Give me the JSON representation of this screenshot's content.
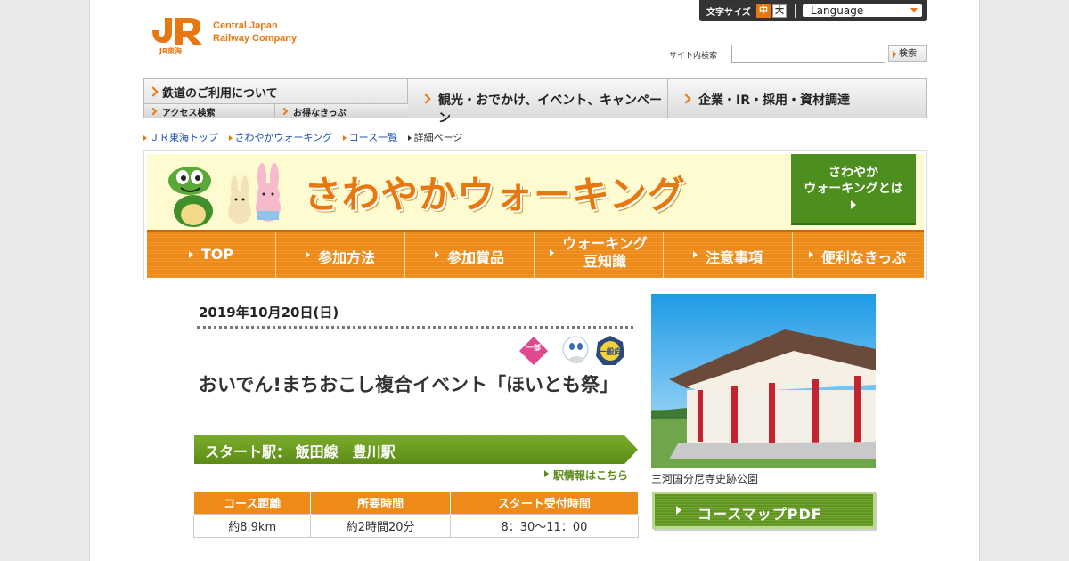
{
  "header": {
    "logo_line1": "Central Japan",
    "logo_line2": "Railway Company",
    "logo_sub": "JR東海",
    "font_size_label": "文字サイズ",
    "font_mid": "中",
    "font_big": "大",
    "language": "Language",
    "search_label": "サイト内検索",
    "search_value": "",
    "search_button": "検索"
  },
  "gnav": {
    "main1": "鉄道のご利用について",
    "sub1": "アクセス検索",
    "sub2": "お得なきっぷ",
    "main2": "観光・おでかけ、イベント、キャンペーン",
    "main3": "企業・IR・採用・資材調達"
  },
  "breadcrumb": [
    "ＪＲ東海トップ",
    "さわやかウォーキング",
    "コース一覧",
    "詳細ページ"
  ],
  "banner": {
    "title": "さわやかウォーキング",
    "whatis_line1": "さわやか",
    "whatis_line2": "ウォーキングとは",
    "nav": [
      {
        "line1": "TOP",
        "line2": ""
      },
      {
        "line1": "参加方法",
        "line2": ""
      },
      {
        "line1": "参加賞品",
        "line2": ""
      },
      {
        "line1": "ウォーキング",
        "line2": "豆知識"
      },
      {
        "line1": "注意事項",
        "line2": ""
      },
      {
        "line1": "便利なきっぷ",
        "line2": ""
      }
    ]
  },
  "event": {
    "date": "2019年10月20日(日)",
    "icon_badges": [
      "一部",
      "一般向"
    ],
    "title": "おいでん!まちおこし複合イベント「ほいとも祭」",
    "start_label": "スタート駅： 飯田線　豊川駅",
    "station_link": "駅情報はこちら",
    "table_headers": [
      "コース距離",
      "所要時間",
      "スタート受付時間"
    ],
    "table_values": [
      "約8.9km",
      "約2時間20分",
      "8：30～11：00"
    ],
    "photo_caption": "三河国分尼寺史跡公園",
    "pdf_button": "コースマップPDF"
  },
  "colors": {
    "accent_orange": "#ee8a17",
    "accent_green": "#5c8c17"
  }
}
